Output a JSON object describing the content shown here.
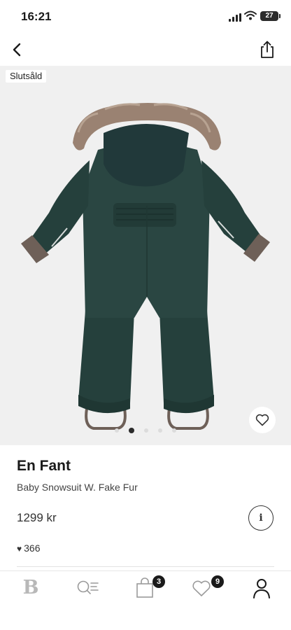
{
  "status_bar": {
    "time": "16:21",
    "battery": "27"
  },
  "product": {
    "badge": "Slutsåld",
    "brand": "En Fant",
    "name": "Baby Snowsuit W. Fake Fur",
    "price": "1299 kr",
    "likes": "366",
    "image_count": 5,
    "image_index": 2
  },
  "tab_bar": {
    "logo": "B",
    "bag_count": "3",
    "favorites_count": "9"
  },
  "colors": {
    "suit": "#25403c",
    "fur": "#9a8272",
    "cuffs": "#6e6058",
    "background": "#f0f0f0"
  },
  "icons": [
    "back-chevron-icon",
    "share-icon",
    "heart-outline-icon",
    "info-icon",
    "search-icon",
    "bag-icon",
    "heart-icon",
    "profile-icon"
  ]
}
